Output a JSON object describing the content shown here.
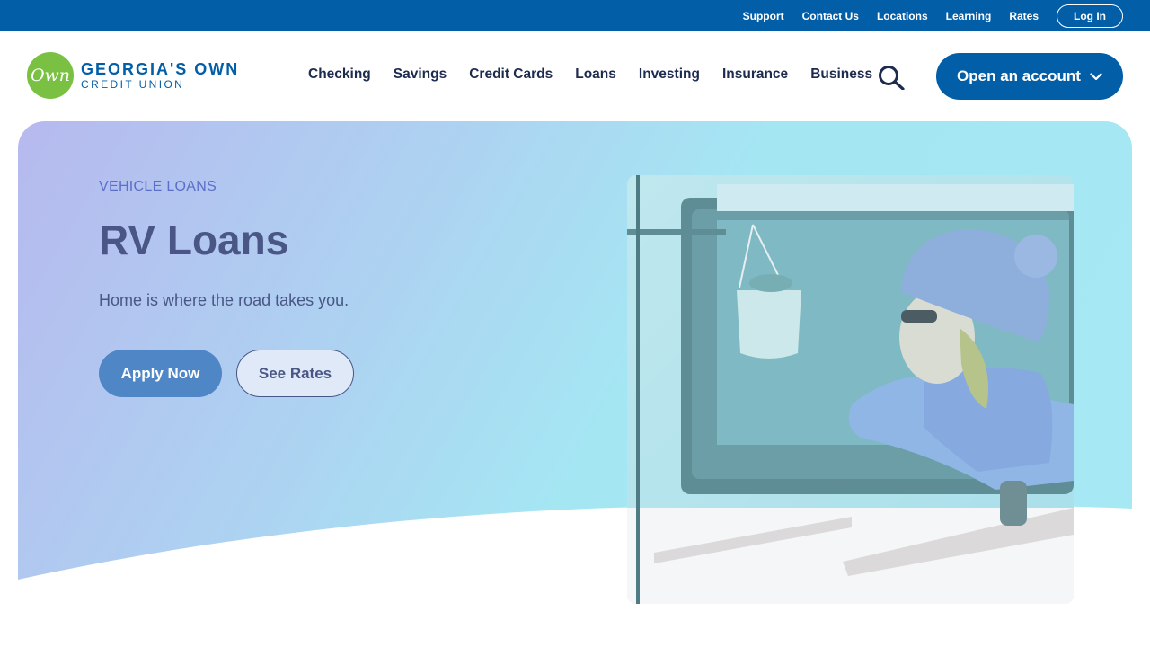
{
  "utility_bar": {
    "links": [
      "Support",
      "Contact Us",
      "Locations",
      "Learning",
      "Rates"
    ],
    "login_label": "Log In",
    "background": "#035ea8"
  },
  "header": {
    "logo": {
      "mark": "Own",
      "line1": "GEORGIA'S OWN",
      "line2": "CREDIT UNION",
      "mark_color": "#7ac143"
    },
    "nav": [
      "Checking",
      "Savings",
      "Credit Cards",
      "Loans",
      "Investing",
      "Insurance",
      "Business"
    ],
    "search_icon": "search-icon",
    "cta_label": "Open an account",
    "cta_icon": "chevron-down-icon"
  },
  "hero": {
    "eyebrow": "VEHICLE LOANS",
    "title": "RV Loans",
    "subtitle": "Home is where the road takes you.",
    "primary_button": "Apply Now",
    "secondary_button": "See Rates",
    "image_subject": "woman in knit hat leaning out of RV window"
  }
}
